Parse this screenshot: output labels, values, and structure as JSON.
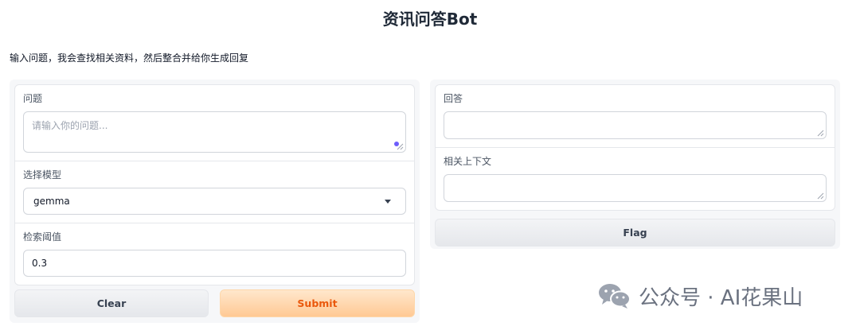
{
  "title": "资讯问答Bot",
  "description": "输入问题，我会查找相关资料，然后整合并给你生成回复",
  "inputs": {
    "question": {
      "label": "问题",
      "placeholder": "请输入你的问题..."
    },
    "model": {
      "label": "选择模型",
      "value": "gemma"
    },
    "threshold": {
      "label": "检索阈值",
      "value": "0.3"
    }
  },
  "outputs": {
    "answer": {
      "label": "回答",
      "value": ""
    },
    "context": {
      "label": "相关上下文",
      "value": ""
    }
  },
  "buttons": {
    "clear": "Clear",
    "submit": "Submit",
    "flag": "Flag"
  },
  "watermark": {
    "text": "公众号 · AI花果山",
    "icon": "wechat-icon"
  },
  "colors": {
    "submit_text": "#ea580c",
    "submit_bg": "#ffc994",
    "accent_dot": "#6d5dfc"
  }
}
